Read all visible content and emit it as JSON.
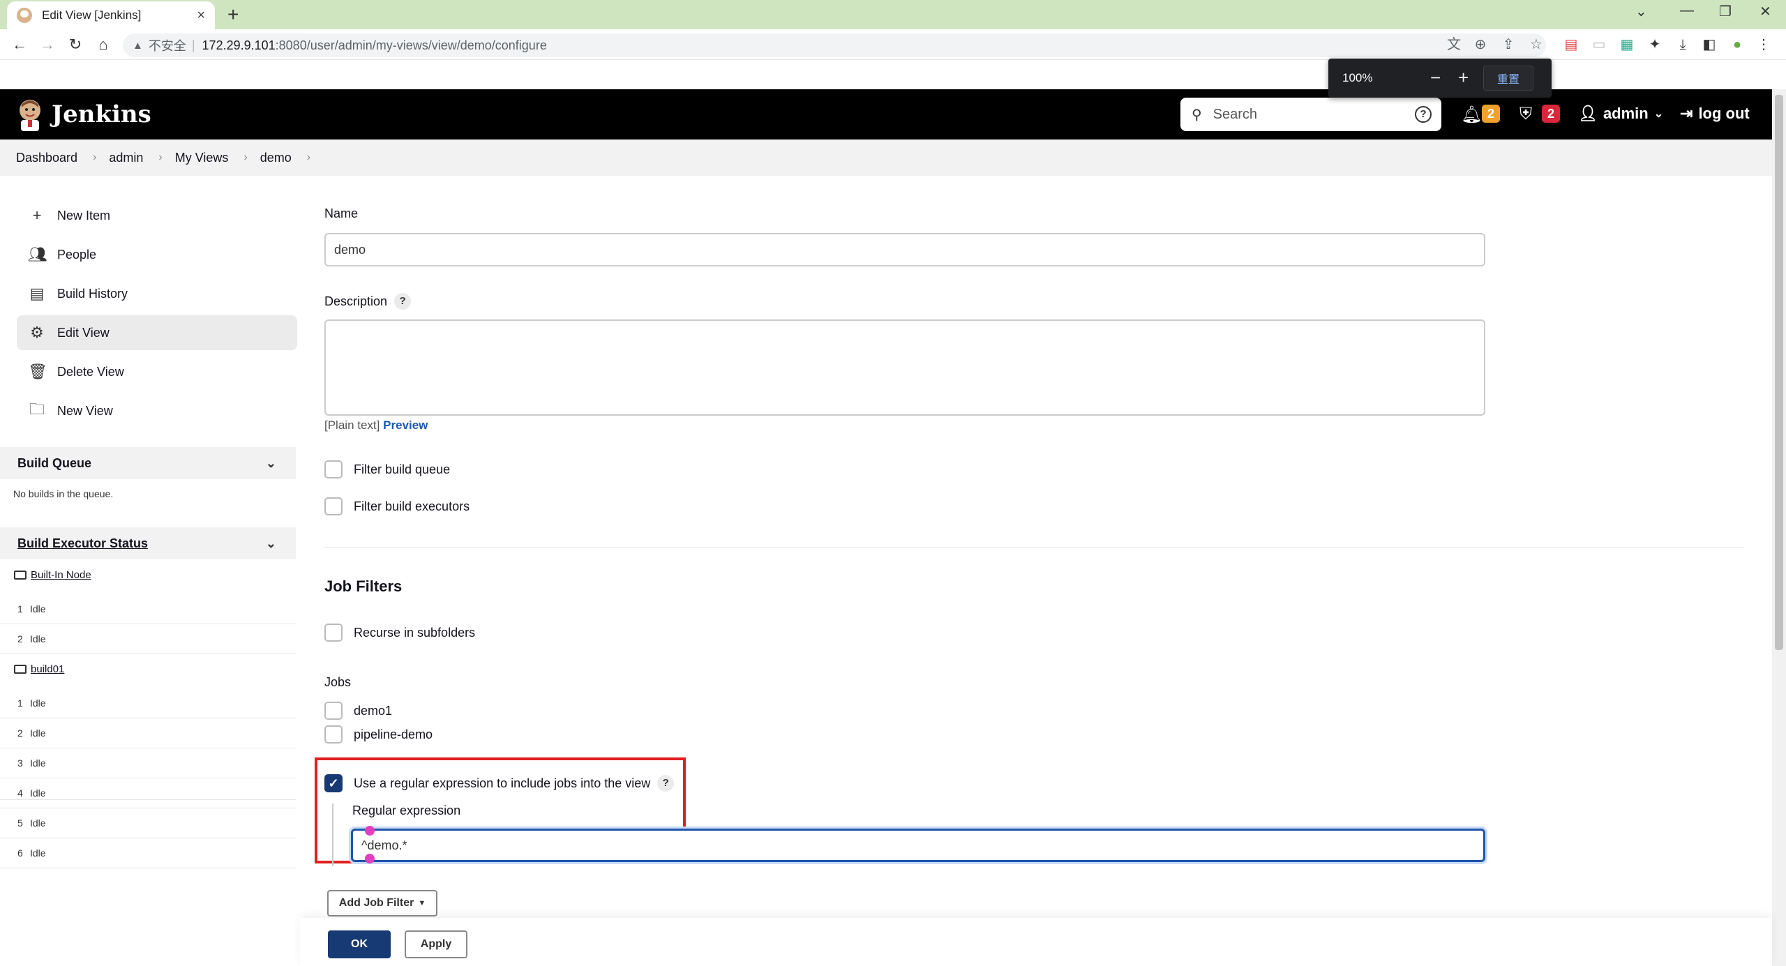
{
  "browser": {
    "tab_title": "Edit View [Jenkins]",
    "insecure_label": "不安全",
    "url_host": "172.29.9.101",
    "url_path": ":8080/user/admin/my-views/view/demo/configure",
    "zoom_level": "100%",
    "zoom_reset_label": "重置"
  },
  "header": {
    "app_name": "Jenkins",
    "search_placeholder": "Search",
    "notifications_count": "2",
    "security_count": "2",
    "user": "admin",
    "logout_label": "log out",
    "colors": {
      "notif_badge": "#f0a02c",
      "security_badge": "#d9263a"
    }
  },
  "breadcrumb": [
    "Dashboard",
    "admin",
    "My Views",
    "demo"
  ],
  "sidebar": {
    "tasks": [
      {
        "label": "New Item",
        "icon": "plus-icon"
      },
      {
        "label": "People",
        "icon": "people-icon"
      },
      {
        "label": "Build History",
        "icon": "history-icon"
      },
      {
        "label": "Edit View",
        "icon": "gear-icon",
        "active": true
      },
      {
        "label": "Delete View",
        "icon": "trash-icon"
      },
      {
        "label": "New View",
        "icon": "folder-icon"
      }
    ],
    "build_queue": {
      "title": "Build Queue",
      "empty_text": "No builds in the queue."
    },
    "executor_status": {
      "title": "Build Executor Status",
      "nodes": [
        {
          "name": "Built-In Node",
          "executors": [
            {
              "num": "1",
              "state": "Idle"
            },
            {
              "num": "2",
              "state": "Idle"
            }
          ]
        },
        {
          "name": "build01",
          "executors": [
            {
              "num": "1",
              "state": "Idle"
            },
            {
              "num": "2",
              "state": "Idle"
            },
            {
              "num": "3",
              "state": "Idle"
            },
            {
              "num": "4",
              "state": "Idle"
            },
            {
              "num": "5",
              "state": "Idle"
            },
            {
              "num": "6",
              "state": "Idle"
            }
          ]
        }
      ]
    }
  },
  "form": {
    "name_label": "Name",
    "name_value": "demo",
    "description_label": "Description",
    "plain_text_label": "[Plain text]",
    "preview_label": "Preview",
    "filter_build_queue": "Filter build queue",
    "filter_build_executors": "Filter build executors",
    "job_filters_title": "Job Filters",
    "recurse_label": "Recurse in subfolders",
    "jobs_label": "Jobs",
    "jobs": [
      "demo1",
      "pipeline-demo"
    ],
    "regex_checkbox_label": "Use a regular expression to include jobs into the view",
    "regex_label": "Regular expression",
    "regex_value": "^demo.*",
    "add_job_filter": "Add Job Filter",
    "ok_label": "OK",
    "apply_label": "Apply"
  }
}
